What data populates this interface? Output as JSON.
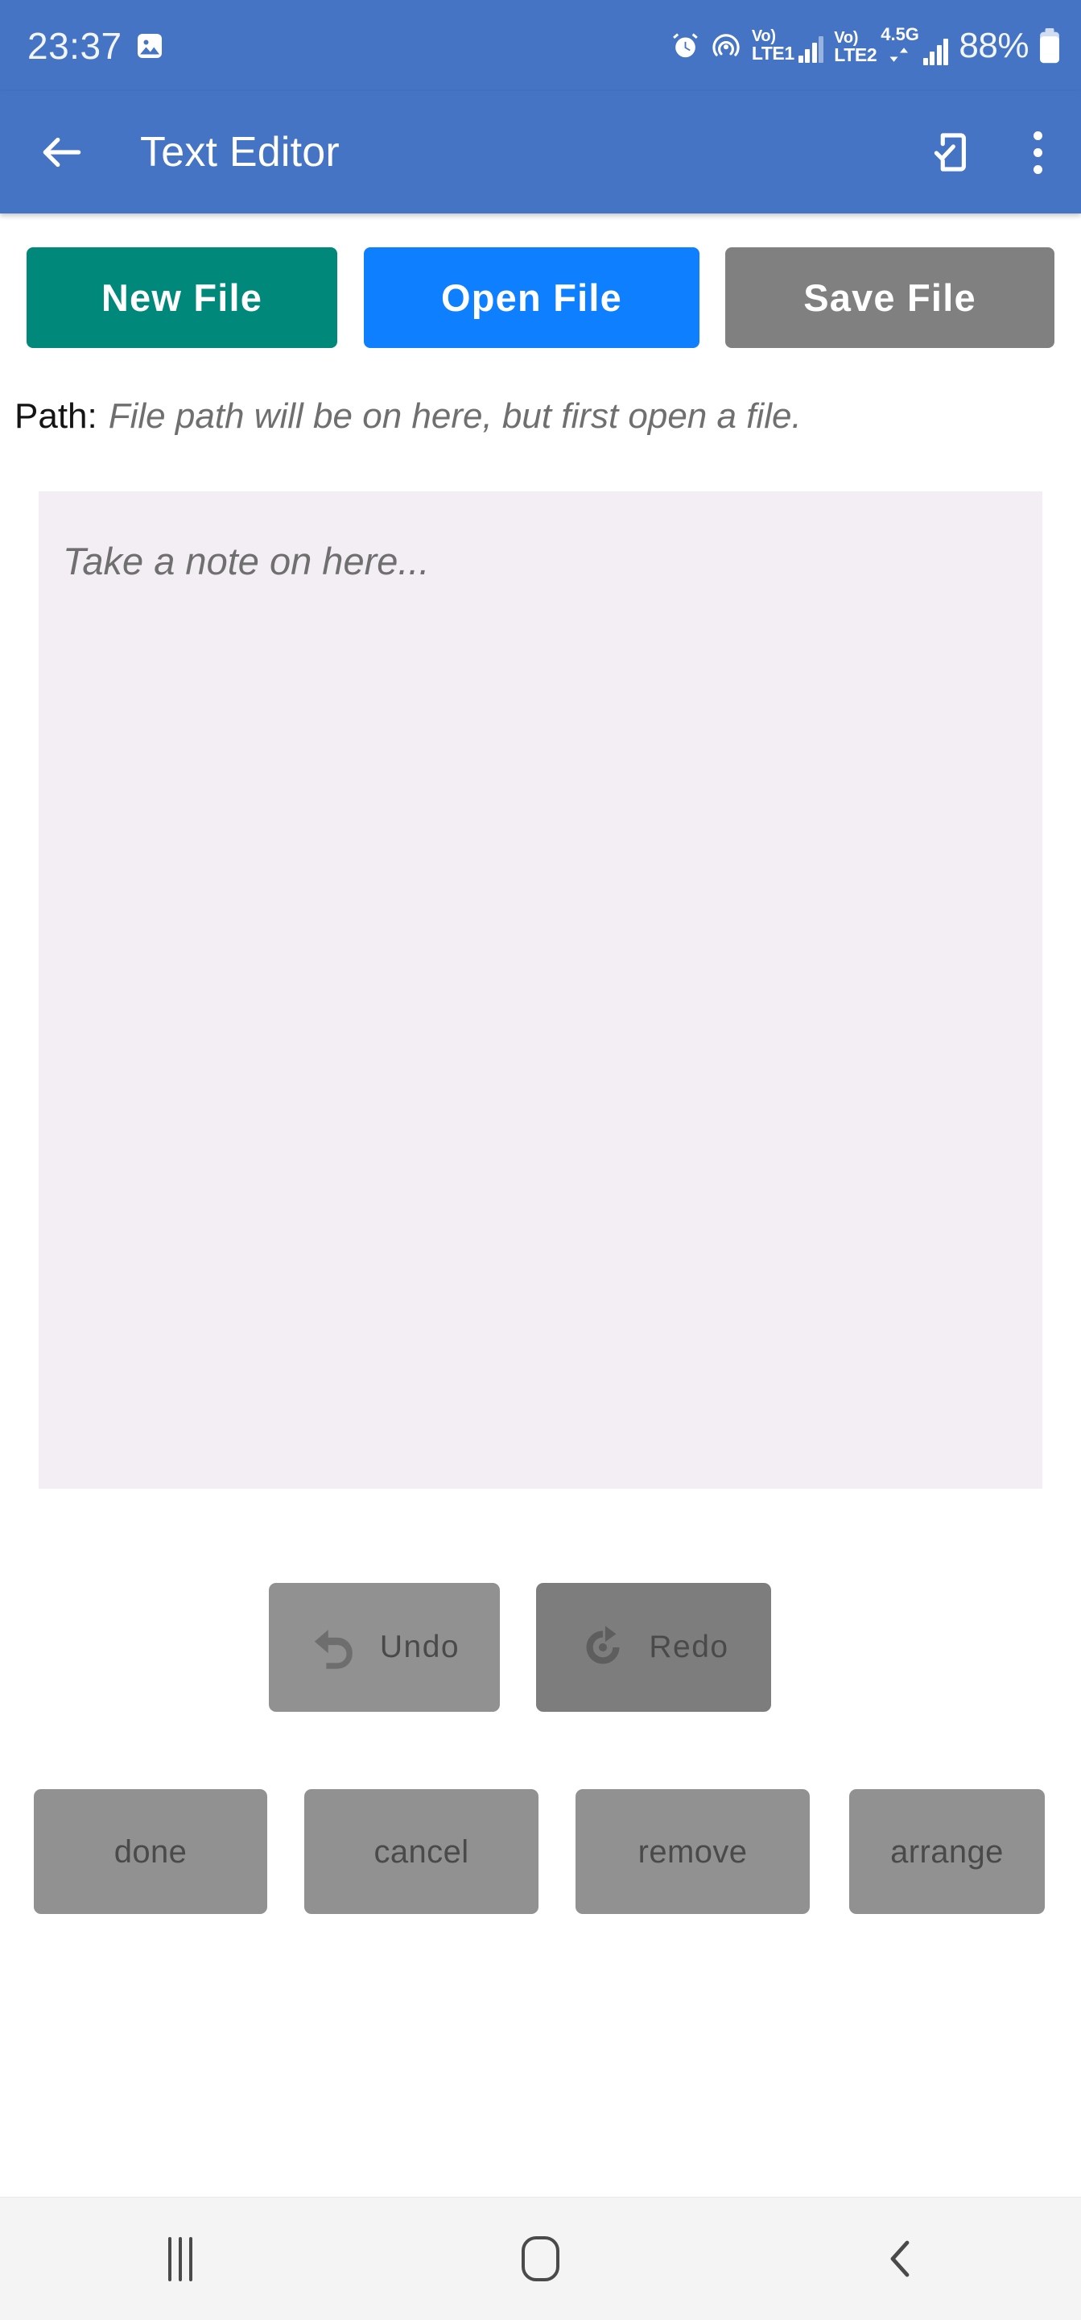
{
  "status_bar": {
    "time": "23:37",
    "battery_percent": "88%",
    "icons": [
      "image-icon",
      "alarm-icon",
      "hotspot-icon",
      "volte-sim1-icon",
      "signal-sim1-icon",
      "volte-sim2-icon",
      "data-transfer-icon",
      "signal-sim2-icon",
      "battery-icon"
    ],
    "sim1": {
      "vo": "Vo)",
      "network": "LTE1"
    },
    "sim2": {
      "vo": "Vo)",
      "network": "LTE2",
      "speed": "4.5G"
    },
    "background_color": "#4574C4"
  },
  "app_bar": {
    "title": "Text Editor",
    "back_icon": "arrow-left-icon",
    "action_icon": "phone-check-icon",
    "overflow_icon": "kebab-menu-icon",
    "background_color": "#4574C4"
  },
  "file_actions": {
    "new_label": "New File",
    "new_color": "#00897B",
    "open_label": "Open File",
    "open_color": "#0D7FFF",
    "save_label": "Save File",
    "save_color": "#808080"
  },
  "path": {
    "label": "Path:",
    "value": "File path will be on here, but first open a file."
  },
  "editor": {
    "placeholder": "Take a note on here...",
    "value": "",
    "background_color": "#F3EEF4"
  },
  "history": {
    "undo_label": "Undo",
    "undo_icon": "undo-arrow-icon",
    "undo_color": "#919191",
    "redo_label": "Redo",
    "redo_icon": "redo-arrow-icon",
    "redo_color": "#7D7D7D"
  },
  "actions": {
    "done_label": "done",
    "cancel_label": "cancel",
    "remove_label": "remove",
    "arrange_label": "arrange",
    "color": "#919191"
  },
  "nav_bar": {
    "recents_icon": "recents-icon",
    "home_icon": "home-icon",
    "back_icon": "nav-back-icon",
    "background_color": "#F4F4F4"
  }
}
